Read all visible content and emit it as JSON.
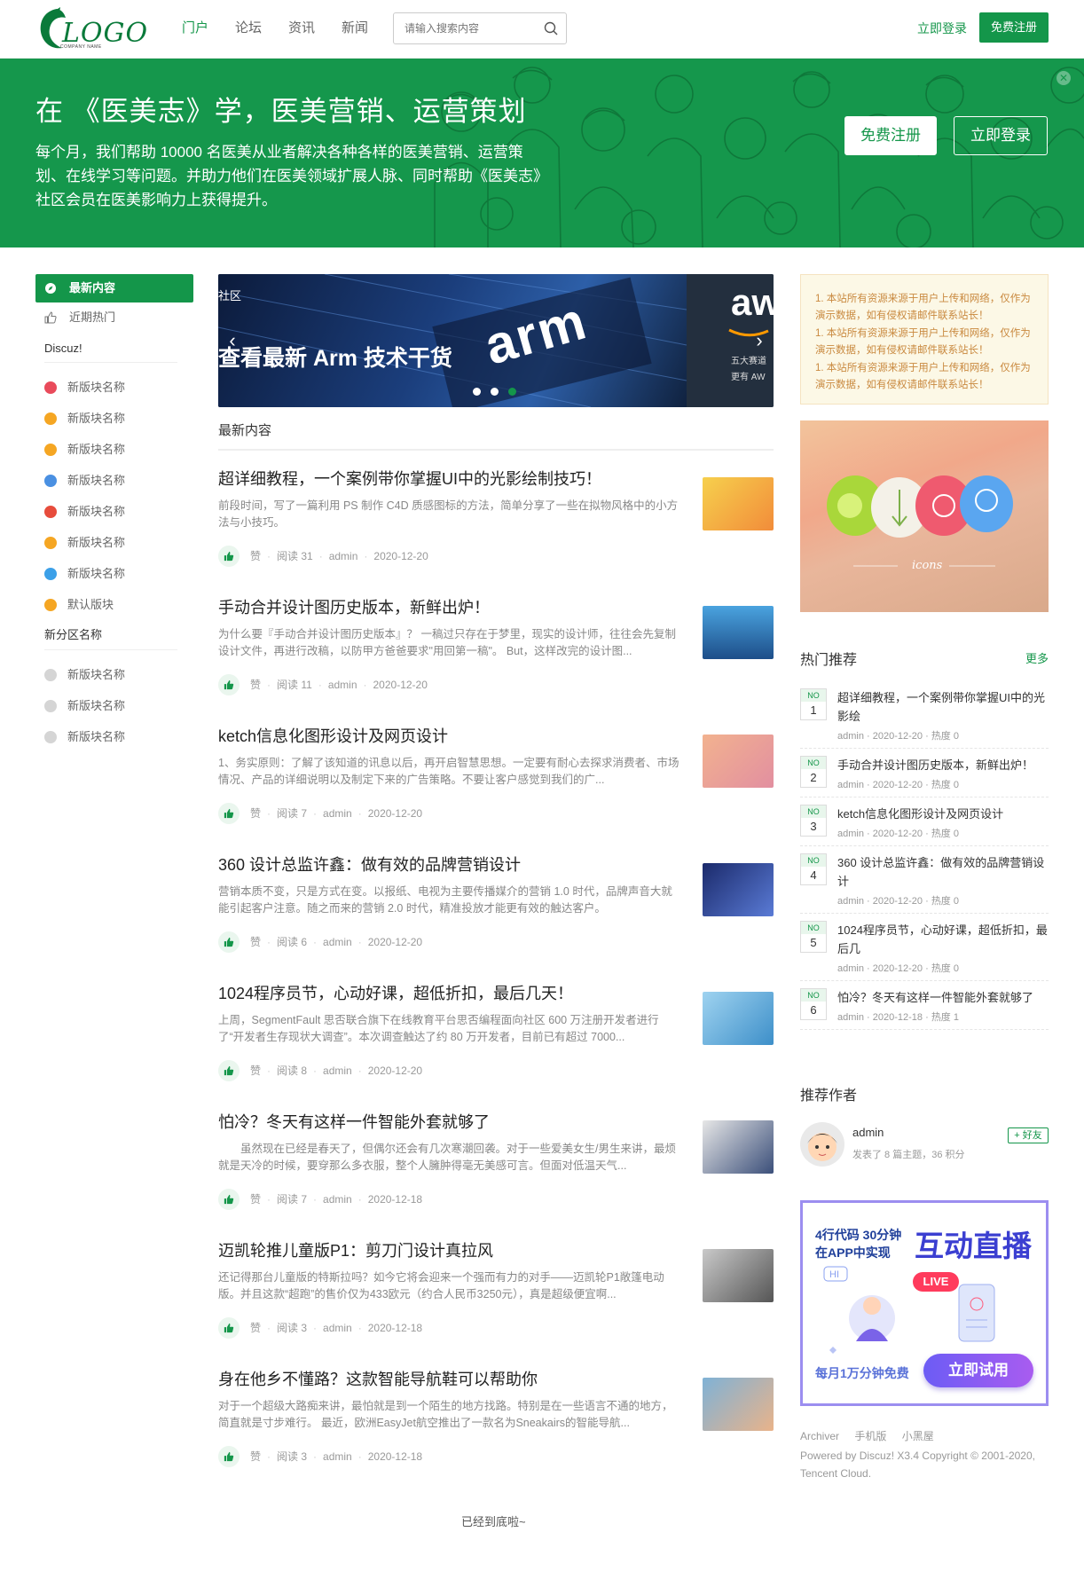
{
  "nav": {
    "logo_text": "LOGO",
    "logo_sub": "COMPANY NAME",
    "links": [
      "门户",
      "论坛",
      "资讯",
      "新闻"
    ],
    "search_placeholder": "请输入搜索内容",
    "login": "立即登录",
    "register": "免费注册"
  },
  "banner": {
    "title": "在 《医美志》学，医美营销、运营策划",
    "desc": "每个月，我们帮助 10000 名医美从业者解决各种各样的医美营销、运营策划、在线学习等问题。并助力他们在医美领域扩展人脉、同时帮助《医美志》社区会员在医美影响力上获得提升。",
    "register": "免费注册",
    "login": "立即登录"
  },
  "left": {
    "menu_active": "最新内容",
    "menu_hot": "近期热门",
    "group1": "Discuz!",
    "group1_items": [
      "新版块名称",
      "新版块名称",
      "新版块名称",
      "新版块名称",
      "新版块名称",
      "新版块名称",
      "新版块名称",
      "默认版块"
    ],
    "group1_colors": [
      "#e94b5b",
      "#f5a623",
      "#f5a623",
      "#4a90e2",
      "#e74c3c",
      "#f5a623",
      "#3ca0e8",
      "#f5a623"
    ],
    "group2": "新分区名称",
    "group2_items": [
      "新版块名称",
      "新版块名称",
      "新版块名称"
    ]
  },
  "slider": {
    "tag": "社区",
    "title": "查看最新 Arm 技术干货",
    "brand": "arm",
    "right_brand": "aw",
    "right_text": "五大赛道 更有 AW"
  },
  "main": {
    "section_title": "最新内容",
    "like_label": "赞",
    "posts": [
      {
        "title": "超详细教程，一个案例带你掌握UI中的光影绘制技巧！",
        "excerpt": "前段时间，写了一篇利用 PS 制作 C4D 质感图标的方法，简单分享了一些在拟物风格中的小方法与小技巧。",
        "read": "阅读 31",
        "author": "admin",
        "date": "2020-12-20"
      },
      {
        "title": "手动合并设计图历史版本，新鲜出炉！",
        "excerpt": "为什么要『手动合并设计图历史版本』？ 一稿过只存在于梦里，现实的设计师，往往会先复制设计文件，再进行改稿，以防甲方爸爸要求\"用回第一稿\"。 But，这样改完的设计图...",
        "read": "阅读 11",
        "author": "admin",
        "date": "2020-12-20"
      },
      {
        "title": "ketch信息化图形设计及网页设计",
        "excerpt": "1、务实原则：了解了该知道的讯息以后，再开启智慧思想。一定要有耐心去探求消费者、市场情况、产品的详细说明以及制定下来的广告策略。不要让客户感觉到我们的广...",
        "read": "阅读 7",
        "author": "admin",
        "date": "2020-12-20"
      },
      {
        "title": "360 设计总监许鑫：做有效的品牌营销设计",
        "excerpt": "营销本质不变，只是方式在变。以报纸、电视为主要传播媒介的营销 1.0 时代，品牌声音大就能引起客户注意。随之而来的营销 2.0 时代，精准投放才能更有效的触达客户。",
        "read": "阅读 6",
        "author": "admin",
        "date": "2020-12-20"
      },
      {
        "title": "1024程序员节，心动好课，超低折扣，最后几天！",
        "excerpt": "上周，SegmentFault 思否联合旗下在线教育平台思否编程面向社区 600 万注册开发者进行了“开发者生存现状大调查”。本次调查触达了约 80 万开发者，目前已有超过 7000...",
        "read": "阅读 8",
        "author": "admin",
        "date": "2020-12-20"
      },
      {
        "title": "怕冷？冬天有这样一件智能外套就够了",
        "excerpt": "　　虽然现在已经是春天了，但偶尔还会有几次寒潮回袭。对于一些爱美女生/男生来讲，最烦就是天冷的时候，要穿那么多衣服，整个人臃肿得毫无美感可言。但面对低温天气...",
        "read": "阅读 7",
        "author": "admin",
        "date": "2020-12-18"
      },
      {
        "title": "迈凯轮推儿童版P1：剪刀门设计真拉风",
        "excerpt": "还记得那台儿童版的特斯拉吗？如今它将会迎来一个强而有力的对手——迈凯轮P1敞篷电动版。并且这款“超跑”的售价仅为433欧元（约合人民币3250元），真是超级便宜啊...",
        "read": "阅读 3",
        "author": "admin",
        "date": "2020-12-18"
      },
      {
        "title": "身在他乡不懂路？这款智能导航鞋可以帮助你",
        "excerpt": "对于一个超级大路痴来讲，最怕就是到一个陌生的地方找路。特别是在一些语言不通的地方，简直就是寸步难行。 最近，欧洲EasyJet航空推出了一款名为Sneakairs的智能导航...",
        "read": "阅读 3",
        "author": "admin",
        "date": "2020-12-18"
      }
    ],
    "end_text": "已经到底啦~"
  },
  "right": {
    "notices": [
      "1. 本站所有资源来源于用户上传和网络，仅作为演示数据，如有侵权请邮件联系站长！",
      "1. 本站所有资源来源于用户上传和网络，仅作为演示数据，如有侵权请邮件联系站长！",
      "1. 本站所有资源来源于用户上传和网络，仅作为演示数据，如有侵权请邮件联系站长！"
    ],
    "image_caption": "icons",
    "hot_title": "热门推荐",
    "hot_more": "更多",
    "hot_no": "NO",
    "hot_heat_prefix": "热度",
    "hot": [
      {
        "num": "1",
        "title": "超详细教程，一个案例带你掌握UI中的光影绘",
        "author": "admin",
        "date": "2020-12-20",
        "heat": "热度 0"
      },
      {
        "num": "2",
        "title": "手动合并设计图历史版本，新鲜出炉！",
        "author": "admin",
        "date": "2020-12-20",
        "heat": "热度 0"
      },
      {
        "num": "3",
        "title": "ketch信息化图形设计及网页设计",
        "author": "admin",
        "date": "2020-12-20",
        "heat": "热度 0"
      },
      {
        "num": "4",
        "title": "360 设计总监许鑫：做有效的品牌营销设计",
        "author": "admin",
        "date": "2020-12-20",
        "heat": "热度 0"
      },
      {
        "num": "5",
        "title": "1024程序员节，心动好课，超低折扣，最后几",
        "author": "admin",
        "date": "2020-12-20",
        "heat": "热度 0"
      },
      {
        "num": "6",
        "title": "怕冷？冬天有这样一件智能外套就够了",
        "author": "admin",
        "date": "2020-12-18",
        "heat": "热度 1"
      }
    ],
    "author_title": "推荐作者",
    "author_name": "admin",
    "author_meta": "发表了 8 篇主题，36 积分",
    "follow": "+ 好友",
    "ad": {
      "line1": "4行代码 30分钟",
      "line2": "在APP中实现",
      "headline": "互动直播",
      "live": "LIVE",
      "hi": "HI",
      "free": "每月1万分钟免费",
      "try": "立即试用"
    },
    "footer_links": [
      "Archiver",
      "手机版",
      "小黑屋"
    ],
    "footer_text": "Powered by Discuz! X3.4 Copyright © 2001-2020, Tencent Cloud."
  },
  "colors": {
    "brand": "#14964a",
    "banner": "#15974c"
  }
}
